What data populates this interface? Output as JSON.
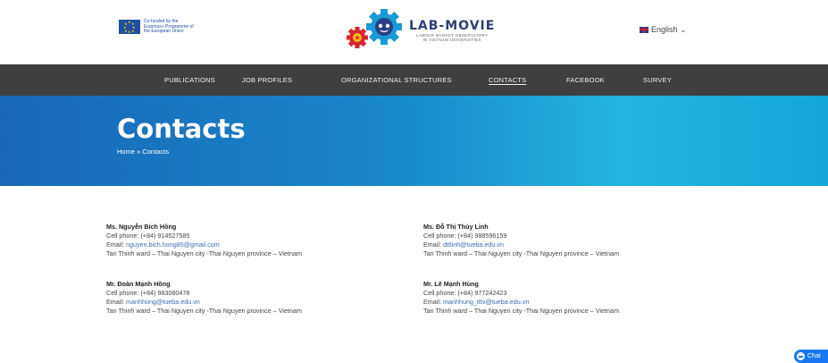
{
  "header": {
    "eu_text": "Co-funded by the Erasmus+ Programme of the European Union",
    "brand_title": "LAB-MOVIE",
    "brand_sub_line1": "LABOUR MARKET OBSERVATORY",
    "brand_sub_line2": "IN VIETNAM UNIVERSITIES",
    "language": "English"
  },
  "nav": {
    "items": [
      {
        "label": "PUBLICATIONS"
      },
      {
        "label": "JOB PROFILES"
      },
      {
        "label": "ORGANIZATIONAL STRUCTURES"
      },
      {
        "label": "CONTACTS",
        "active": true
      },
      {
        "label": "FACEBOOK"
      },
      {
        "label": "SURVEY"
      }
    ]
  },
  "hero": {
    "title": "Contacts",
    "breadcrumb": "Home » Contacts"
  },
  "contacts": [
    {
      "name": "Ms. Nguyễn Bích Hồng",
      "phone": "Cell phone: (+84) 914527585",
      "email_label": "Email: ",
      "email": "nguyen.bich.hong85@gmail.com",
      "address": "Tan Thinh ward – Thai Nguyen city -Thai Nguyen province – Vietnam"
    },
    {
      "name": "Ms. Đỗ Thị Thùy Linh",
      "phone": "Cell phone: (+84) 988596159",
      "email_label": "Email: ",
      "email": "dttlinh@tueba.edu.vn",
      "address": "Tan Thinh ward – Thai Nguyen city -Thai Nguyen province – Vietnam"
    },
    {
      "name": "Mr. Đoàn Mạnh Hồng",
      "phone": "Cell phone: (+84) 983080478",
      "email_label": "Email: ",
      "email": "manhhong@tueba.edu.vn",
      "address": "Tan Thinh ward – Thai Nguyen city -Thai Nguyen province – Vietnam"
    },
    {
      "name": "Mr. Lê Mạnh Hùng",
      "phone": "Cell phone: (+84) 977242423",
      "email_label": "Email: ",
      "email": "manhhung_tttv@tueba.edu.vn",
      "address": "Tan Thinh ward – Thai Nguyen city -Thai Nguyen province – Vietnam"
    }
  ],
  "chat": {
    "label": "Chat"
  },
  "colors": {
    "nav_bg": "#3f3f3f",
    "hero_start": "#1a67b7",
    "hero_end": "#22b4de",
    "link": "#3b6db3",
    "brand": "#2d3e78"
  },
  "icons": [
    "eu-flag-icon",
    "gear-logo-icon",
    "uk-flag-icon",
    "chevron-down-icon",
    "messenger-icon"
  ]
}
